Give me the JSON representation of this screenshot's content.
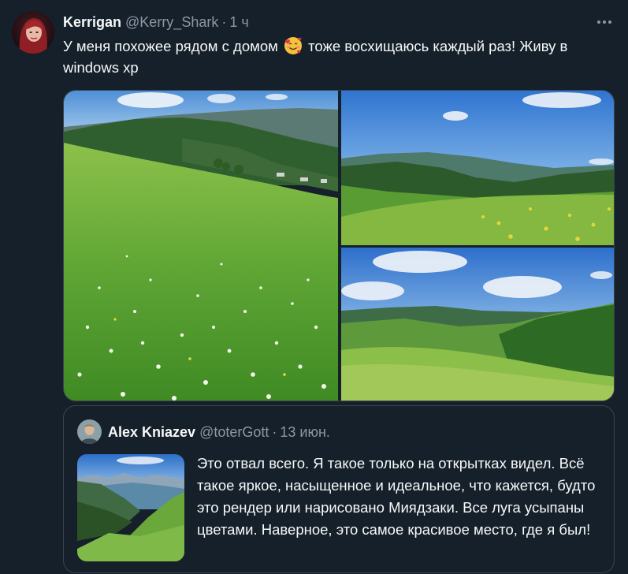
{
  "tweet": {
    "display_name": "Kerrigan",
    "handle": "@Kerry_Shark",
    "separator": "·",
    "time": "1 ч",
    "text_before_emoji": "У меня похожее рядом с домом",
    "emoji_name": "smiling-face-with-hearts-icon",
    "text_after_emoji": "тоже восхищаюсь каждый раз! Живу в windows xp",
    "media_count": 3
  },
  "quoted": {
    "display_name": "Alex Kniazev",
    "handle": "@toterGott",
    "separator": "·",
    "time": "13 июн.",
    "text": "Это отвал всего. Я такое только на открытках видел. Всё такое яркое, насыщенное и идеальное, что кажется, будто это рендер или нарисовано Миядзаки. Все луга усыпаны цветами. Наверное, это самое красивое место, где я был!"
  },
  "colors": {
    "background": "#15202b",
    "text_primary": "#f7f9f9",
    "text_secondary": "#8b98a5",
    "border": "#38444d"
  },
  "icons": {
    "more": "more-horizontal-icon"
  }
}
